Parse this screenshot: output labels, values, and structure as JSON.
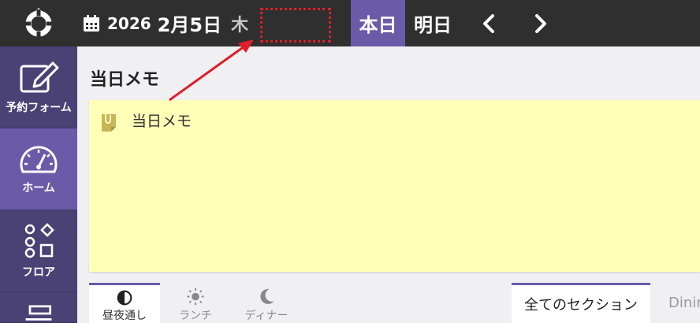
{
  "header": {
    "year": "2026",
    "month_day": "2月5日",
    "weekday": "木",
    "today_label": "本日",
    "tomorrow_label": "明日",
    "prev_icon": "chevron-left-icon",
    "next_icon": "chevron-right-icon",
    "calendar_icon": "calendar-icon"
  },
  "sidebar": {
    "items": [
      {
        "label": "予約フォーム",
        "icon": "edit-icon"
      },
      {
        "label": "ホーム",
        "icon": "dashboard-icon"
      },
      {
        "label": "フロア",
        "icon": "floor-icon"
      }
    ]
  },
  "main": {
    "memo_title": "当日メモ",
    "memo_placeholder": "当日メモ",
    "meal_tabs": [
      {
        "label": "昼夜通し",
        "icon": "half-circle-icon"
      },
      {
        "label": "ランチ",
        "icon": "sun-icon"
      },
      {
        "label": "ディナー",
        "icon": "moon-icon"
      }
    ],
    "section_tabs": [
      {
        "label": "全てのセクション"
      },
      {
        "label": "Dinin"
      }
    ]
  },
  "colors": {
    "accent": "#6a5aa8",
    "sidebar": "#4a4275",
    "topbar": "#2f2f2f",
    "memo_bg": "#ffffb7",
    "annotation": "#e01e26"
  }
}
